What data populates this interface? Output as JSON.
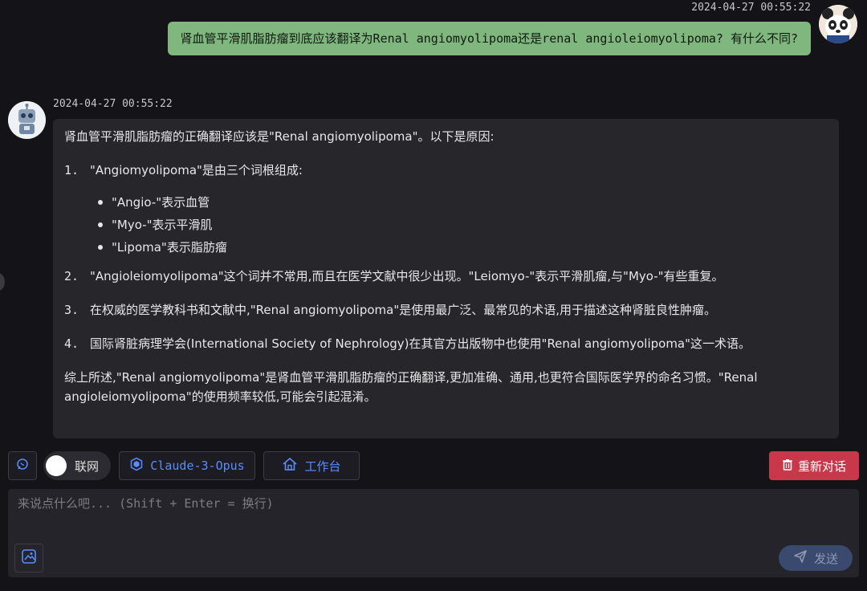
{
  "user_message": {
    "timestamp": "2024-04-27 00:55:22",
    "text": "肾血管平滑肌脂肪瘤到底应该翻译为Renal angiomyolipoma还是renal angioleiomyolipoma? 有什么不同?"
  },
  "assistant_message": {
    "timestamp": "2024-04-27 00:55:22",
    "intro": "肾血管平滑肌脂肪瘤的正确翻译应该是\"Renal angiomyolipoma\"。以下是原因:",
    "points": [
      {
        "num": "1.",
        "text": "\"Angiomyolipoma\"是由三个词根组成:",
        "sub": [
          "\"Angio-\"表示血管",
          "\"Myo-\"表示平滑肌",
          "\"Lipoma\"表示脂肪瘤"
        ]
      },
      {
        "num": "2.",
        "text": "\"Angioleiomyolipoma\"这个词并不常用,而且在医学文献中很少出现。\"Leiomyo-\"表示平滑肌瘤,与\"Myo-\"有些重复。"
      },
      {
        "num": "3.",
        "text": "在权威的医学教科书和文献中,\"Renal angiomyolipoma\"是使用最广泛、最常见的术语,用于描述这种肾脏良性肿瘤。"
      },
      {
        "num": "4.",
        "text": "国际肾脏病理学会(International Society of Nephrology)在其官方出版物中也使用\"Renal angiomyolipoma\"这一术语。"
      }
    ],
    "summary": "综上所述,\"Renal angiomyolipoma\"是肾血管平滑肌脂肪瘤的正确翻译,更加准确、通用,也更符合国际医学界的命名习惯。\"Renal angioleiomyolipoma\"的使用频率较低,可能会引起混淆。"
  },
  "toolbar": {
    "web_toggle_label": "联网",
    "model_label": "Claude-3-Opus",
    "workspace_label": "工作台",
    "reset_label": "重新对话"
  },
  "input": {
    "placeholder": "来说点什么吧... (Shift + Enter = 换行)",
    "value": "",
    "send_label": "发送"
  },
  "colors": {
    "user_bubble": "#7fb77e",
    "reset_button": "#c8384a",
    "accent": "#5b8cff",
    "background": "#131318"
  },
  "icons": [
    "panda-avatar-icon",
    "robot-avatar-icon",
    "chat-bubble-icon",
    "cube-icon",
    "home-icon",
    "trash-icon",
    "image-icon",
    "send-icon"
  ]
}
